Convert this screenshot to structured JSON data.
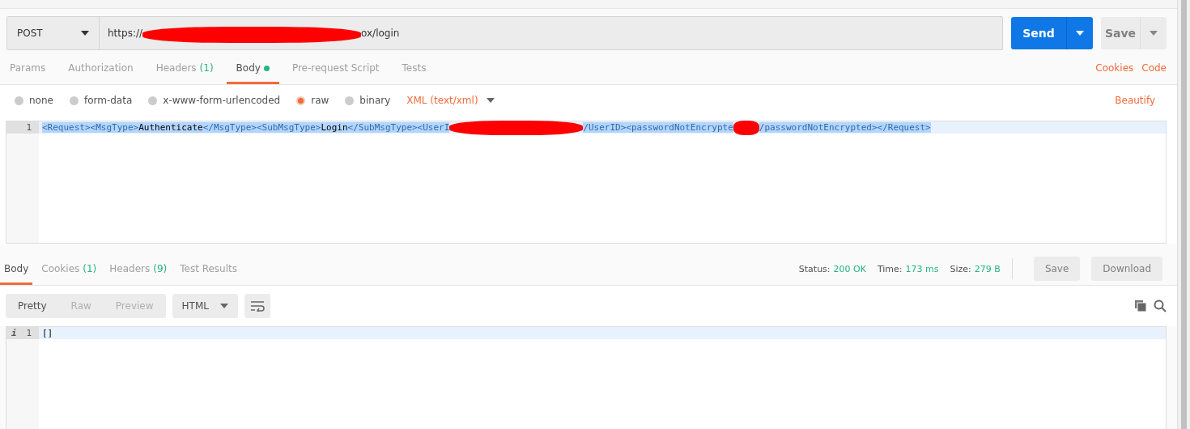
{
  "request": {
    "method": "POST",
    "url_parts": [
      {
        "kind": "text",
        "text": "https://"
      },
      {
        "kind": "redaction"
      },
      {
        "kind": "text",
        "text": "ox/login"
      }
    ],
    "send": "Send",
    "save": "Save"
  },
  "request_tabs": [
    {
      "label": "Params",
      "selected": false
    },
    {
      "label": "Authorization",
      "selected": false
    },
    {
      "label": "Headers",
      "count": "(1)",
      "selected": false
    },
    {
      "label": "Body",
      "dot": true,
      "selected": true
    },
    {
      "label": "Pre-request Script",
      "selected": false
    },
    {
      "label": "Tests",
      "selected": false
    }
  ],
  "request_links": [
    "Cookies",
    "Code"
  ],
  "body_types": [
    {
      "label": "none",
      "selected": false
    },
    {
      "label": "form-data",
      "selected": false
    },
    {
      "label": "x-www-form-urlencoded",
      "selected": false
    },
    {
      "label": "raw",
      "selected": true
    },
    {
      "label": "binary",
      "selected": false
    }
  ],
  "content_type": "XML (text/xml)",
  "beautify": "Beautify",
  "request_editor": {
    "line_number": "1",
    "segments": [
      {
        "kind": "tag",
        "text": "<Request><MsgType>"
      },
      {
        "kind": "text",
        "text": "Authenticate"
      },
      {
        "kind": "tag",
        "text": "</MsgType><SubMsgType>"
      },
      {
        "kind": "text",
        "text": "Login"
      },
      {
        "kind": "tag",
        "text": "</SubMsgType><UserI"
      },
      {
        "kind": "redaction"
      },
      {
        "kind": "tag",
        "text": "/UserID><passwordNotEncrypte"
      },
      {
        "kind": "redaction"
      },
      {
        "kind": "tag",
        "text": "/passwordNotEncrypted></Request>"
      }
    ]
  },
  "response_tabs": [
    {
      "label": "Body",
      "selected": true
    },
    {
      "label": "Cookies",
      "count": "(1)",
      "selected": false
    },
    {
      "label": "Headers",
      "count": "(9)",
      "selected": false
    },
    {
      "label": "Test Results",
      "selected": false
    }
  ],
  "response_meta": [
    {
      "label": "Status:",
      "value": "200 OK"
    },
    {
      "label": "Time:",
      "value": "173 ms"
    },
    {
      "label": "Size:",
      "value": "279 B"
    }
  ],
  "response_buttons": [
    "Save",
    "Download"
  ],
  "view_modes": [
    {
      "label": "Pretty",
      "selected": true
    },
    {
      "label": "Raw",
      "selected": false
    },
    {
      "label": "Preview",
      "selected": false
    }
  ],
  "format": "HTML",
  "response_editor": {
    "info_mark": "i",
    "line_number": "1",
    "content": "[]"
  }
}
